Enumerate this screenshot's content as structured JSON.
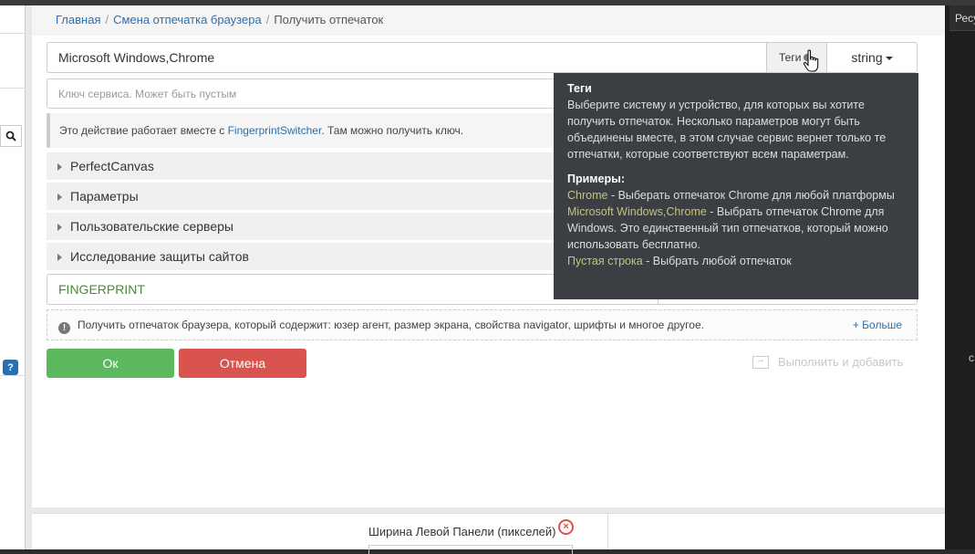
{
  "breadcrumb": {
    "home": "Главная",
    "section": "Смена отпечатка браузера",
    "current": "Получить отпечаток",
    "divider": "/"
  },
  "main_input": {
    "value": "Microsoft Windows,Chrome"
  },
  "tags_button": {
    "label": "Теги"
  },
  "type_dropdown": {
    "label": "string"
  },
  "key_input": {
    "placeholder": "Ключ сервиса. Может быть пустым"
  },
  "info": {
    "prefix": "Это действие работает вместе с ",
    "link": "FingerprintSwitcher",
    "suffix": ". Там можно получить ключ."
  },
  "accordion": [
    {
      "label": "PerfectCanvas"
    },
    {
      "label": "Параметры"
    },
    {
      "label": "Пользовательские серверы"
    },
    {
      "label": "Исследование защиты сайтов"
    }
  ],
  "result_variable": {
    "value": "FINGERPRINT"
  },
  "description": {
    "text": "Получить отпечаток браузера, который содержит: юзер агент, размер экрана, свойства navigator, шрифты и многое другое.",
    "more": "+ Больше"
  },
  "buttons": {
    "ok": "Ок",
    "cancel": "Отмена",
    "run_add": "Выполнить и добавить"
  },
  "tooltip": {
    "title": "Теги",
    "text": "Выберите систему и устройство, для которых вы хотите получить отпечаток. Несколько параметров могут быть объединены вместе, в этом случае сервис вернет только те отпечатки, которые соответствуют всем параметрам.",
    "examples_title": "Примеры:",
    "ex1_key": "Chrome",
    "ex1_text": " - Выберать отпечаток Chrome для любой платформы",
    "ex2_key": "Microsoft Windows,Chrome",
    "ex2_text": " - Выбрать отпечаток Chrome для Windows. Это единственный тип отпечатков, который можно использовать бесплатно.",
    "ex3_key": "Пустая строка",
    "ex3_text": " - Выбрать любой отпечаток"
  },
  "bottom_panel": {
    "width_label": "Ширина Левой Панели (пикселей)"
  },
  "right_panel": {
    "header": "Ресу",
    "letter": "с"
  },
  "icons": {
    "search": "search-icon",
    "help": "help-icon",
    "info": "info-icon",
    "tags": "tag-icon",
    "run_add": "run-add-icon",
    "close": "close-icon",
    "cursor": "hand-pointer-icon"
  },
  "colors": {
    "ok": "#5cb85c",
    "cancel": "#d9534f",
    "link": "#2a6fb0",
    "tooltip_bg": "#3b3e42",
    "tooltip_highlight": "#c4c47a",
    "variable": "#4a8a3a"
  }
}
